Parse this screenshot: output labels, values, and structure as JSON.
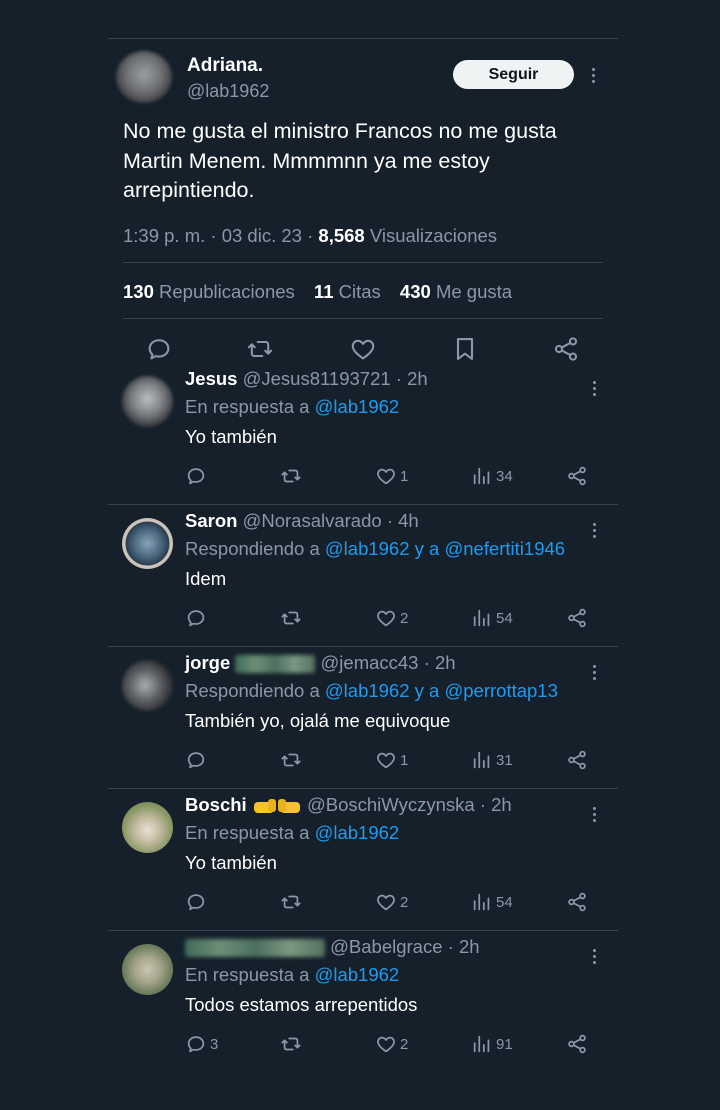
{
  "post": {
    "author": {
      "display_name": "Adriana.",
      "handle": "@lab1962",
      "avatar_icon": "blurred-profile-avatar"
    },
    "follow_label": "Seguir",
    "text": "No me gusta el ministro Francos no me gusta Martin Menem. Mmmmnn ya me estoy arrepintiendo.",
    "time": "1:39 p. m.",
    "date": "03 dic. 23",
    "views_count": "8,568",
    "views_label": "Visualizaciones",
    "reposts_count": "130",
    "reposts_label": "Republicaciones",
    "quotes_count": "11",
    "quotes_label": "Citas",
    "likes_count": "430",
    "likes_label": "Me gusta"
  },
  "replies": [
    {
      "name": "Jesus",
      "handle": "@Jesus81193721",
      "age": "2h",
      "context_prefix": "En respuesta a",
      "context_links": "@lab1962",
      "text": "Yo también",
      "reply_count": "",
      "like_count": "1",
      "view_count": "34"
    },
    {
      "name": "Saron",
      "handle": "@Norasalvarado",
      "age": "4h",
      "context_prefix": "Respondiendo a",
      "context_links": "@lab1962 y a @nefertiti1946",
      "text": "Idem",
      "reply_count": "",
      "like_count": "2",
      "view_count": "54"
    },
    {
      "name": "jorge",
      "handle": "@jemacc43",
      "age": "2h",
      "context_prefix": "Respondiendo a",
      "context_links": "@lab1962 y a @perrottap13",
      "text": "También yo, ojalá me equivoque",
      "reply_count": "",
      "like_count": "1",
      "view_count": "31"
    },
    {
      "name": "Boschi",
      "handle": "@BoschiWyczynska",
      "age": "2h",
      "context_prefix": "En respuesta a",
      "context_links": "@lab1962",
      "text": "Yo también",
      "reply_count": "",
      "like_count": "2",
      "view_count": "54"
    },
    {
      "name": "",
      "handle": "@Babelgrace",
      "age": "2h",
      "context_prefix": "En respuesta a",
      "context_links": "@lab1962",
      "text": "Todos estamos arrepentidos",
      "reply_count": "3",
      "like_count": "2",
      "view_count": "91"
    }
  ],
  "separator": "·",
  "colors": {
    "background": "#15202b",
    "link": "#1d9bf0",
    "muted": "#8b98a5",
    "divider": "#38444d"
  }
}
